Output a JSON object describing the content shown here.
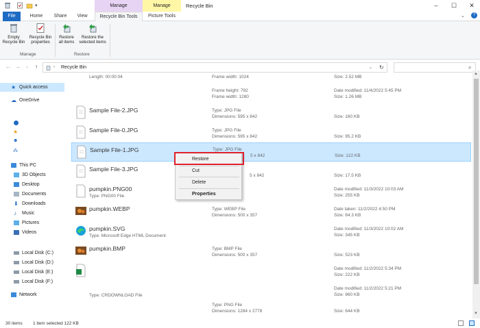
{
  "window": {
    "title": "Recycle Bin",
    "context_tabs": [
      {
        "label": "Manage",
        "color": "#e7d4f5"
      },
      {
        "label": "Manage",
        "color": "#fff7a6"
      }
    ]
  },
  "ribbon_tabs": [
    "File",
    "Home",
    "Share",
    "View",
    "Recycle Bin Tools",
    "Picture Tools"
  ],
  "ribbon": {
    "buttons": [
      {
        "label1": "Empty",
        "label2": "Recycle Bin"
      },
      {
        "label1": "Recycle Bin",
        "label2": "properties"
      },
      {
        "label1": "Restore",
        "label2": "all items"
      },
      {
        "label1": "Restore the",
        "label2": "selected items"
      }
    ],
    "groups": [
      "Manage",
      "Restore"
    ]
  },
  "address": {
    "path": "Recycle Bin"
  },
  "nav": {
    "quick_access": "Quick access",
    "onedrive": "OneDrive",
    "this_pc": "This PC",
    "items": [
      "3D Objects",
      "Desktop",
      "Documents",
      "Downloads",
      "Music",
      "Pictures",
      "Videos"
    ],
    "drives": [
      "Local Disk (C:)",
      "Local Disk (D:)",
      "Local Disk (E:)",
      "Local Disk (F:)"
    ],
    "network": "Network"
  },
  "files": [
    {
      "name": "",
      "type": "Length: 00:00:04",
      "c2a": "Frame width: 1024",
      "c2b": "",
      "c3a": "Size: 2.52 MB",
      "c3b": ""
    },
    {
      "name": "",
      "type": "",
      "c2a": "Frame height: 792",
      "c2b": "Frame width: 1280",
      "c3a": "Date modified: 11/4/2022 5:45 PM",
      "c3b": "Size: 1.26 MB"
    },
    {
      "name": "Sample File-2.JPG",
      "type": "",
      "c2a": "Type: JPG File",
      "c2b": "Dimensions: 595 x 842",
      "c3a": "",
      "c3b": "Size: 160 KB"
    },
    {
      "name": "Sample File-0.JPG",
      "type": "",
      "c2a": "Type: JPG File",
      "c2b": "Dimensions: 595 x 842",
      "c3a": "",
      "c3b": "Size: 95.2 KB"
    },
    {
      "name": "Sample File-1.JPG",
      "type": "",
      "c2a": "Type: JPG File",
      "c2b": "5 x 842",
      "c3a": "",
      "c3b": "Size: 122 KB"
    },
    {
      "name": "Sample File-3.JPG",
      "type": "",
      "c2a": "",
      "c2b": "5 x 842",
      "c3a": "",
      "c3b": "Size: 17.5 KB"
    },
    {
      "name": "pumpkin.PNG00",
      "type": "Type: PNG00 File",
      "c2a": "",
      "c2b": "",
      "c3a": "Date modified: 11/3/2022 10:03 AM",
      "c3b": "Size: 255 KB"
    },
    {
      "name": "pumpkin.WEBP",
      "type": "",
      "c2a": "Type: WEBP File",
      "c2b": "Dimensions: 500 x 357",
      "c3a": "Date taken: 11/2/2022 4:50 PM",
      "c3b": "Size: 64.3 KB"
    },
    {
      "name": "pumpkin.SVG",
      "type": "Type: Microsoft Edge HTML Document",
      "c2a": "",
      "c2b": "",
      "c3a": "Date modified: 11/3/2022 10:02 AM",
      "c3b": "Size: 345 KB"
    },
    {
      "name": "pumpkin.BMP",
      "type": "",
      "c2a": "Type: BMP File",
      "c2b": "Dimensions: 500 x 357",
      "c3a": "",
      "c3b": "Size: 523 KB"
    },
    {
      "name": "",
      "type": "",
      "c2a": "",
      "c2b": "",
      "c3a": "Date modified: 11/2/2022 5:34 PM",
      "c3b": "Size: 222 KB"
    },
    {
      "name": "",
      "type": "Type: CRDOWNLOAD File",
      "c2a": "",
      "c2b": "",
      "c3a": "Date modified: 11/2/2022 5:21 PM",
      "c3b": "Size: 960 KB"
    },
    {
      "name": "",
      "type": "",
      "c2a": "Type: PNG File",
      "c2b": "Dimensions: 1284 x 2778",
      "c3a": "",
      "c3b": "Size: 644 KB"
    }
  ],
  "context_menu": {
    "items": [
      "Restore",
      "Cut",
      "Delete",
      "Properties"
    ]
  },
  "status": {
    "count": "30 items",
    "selected": "1 item selected  122 KB"
  }
}
